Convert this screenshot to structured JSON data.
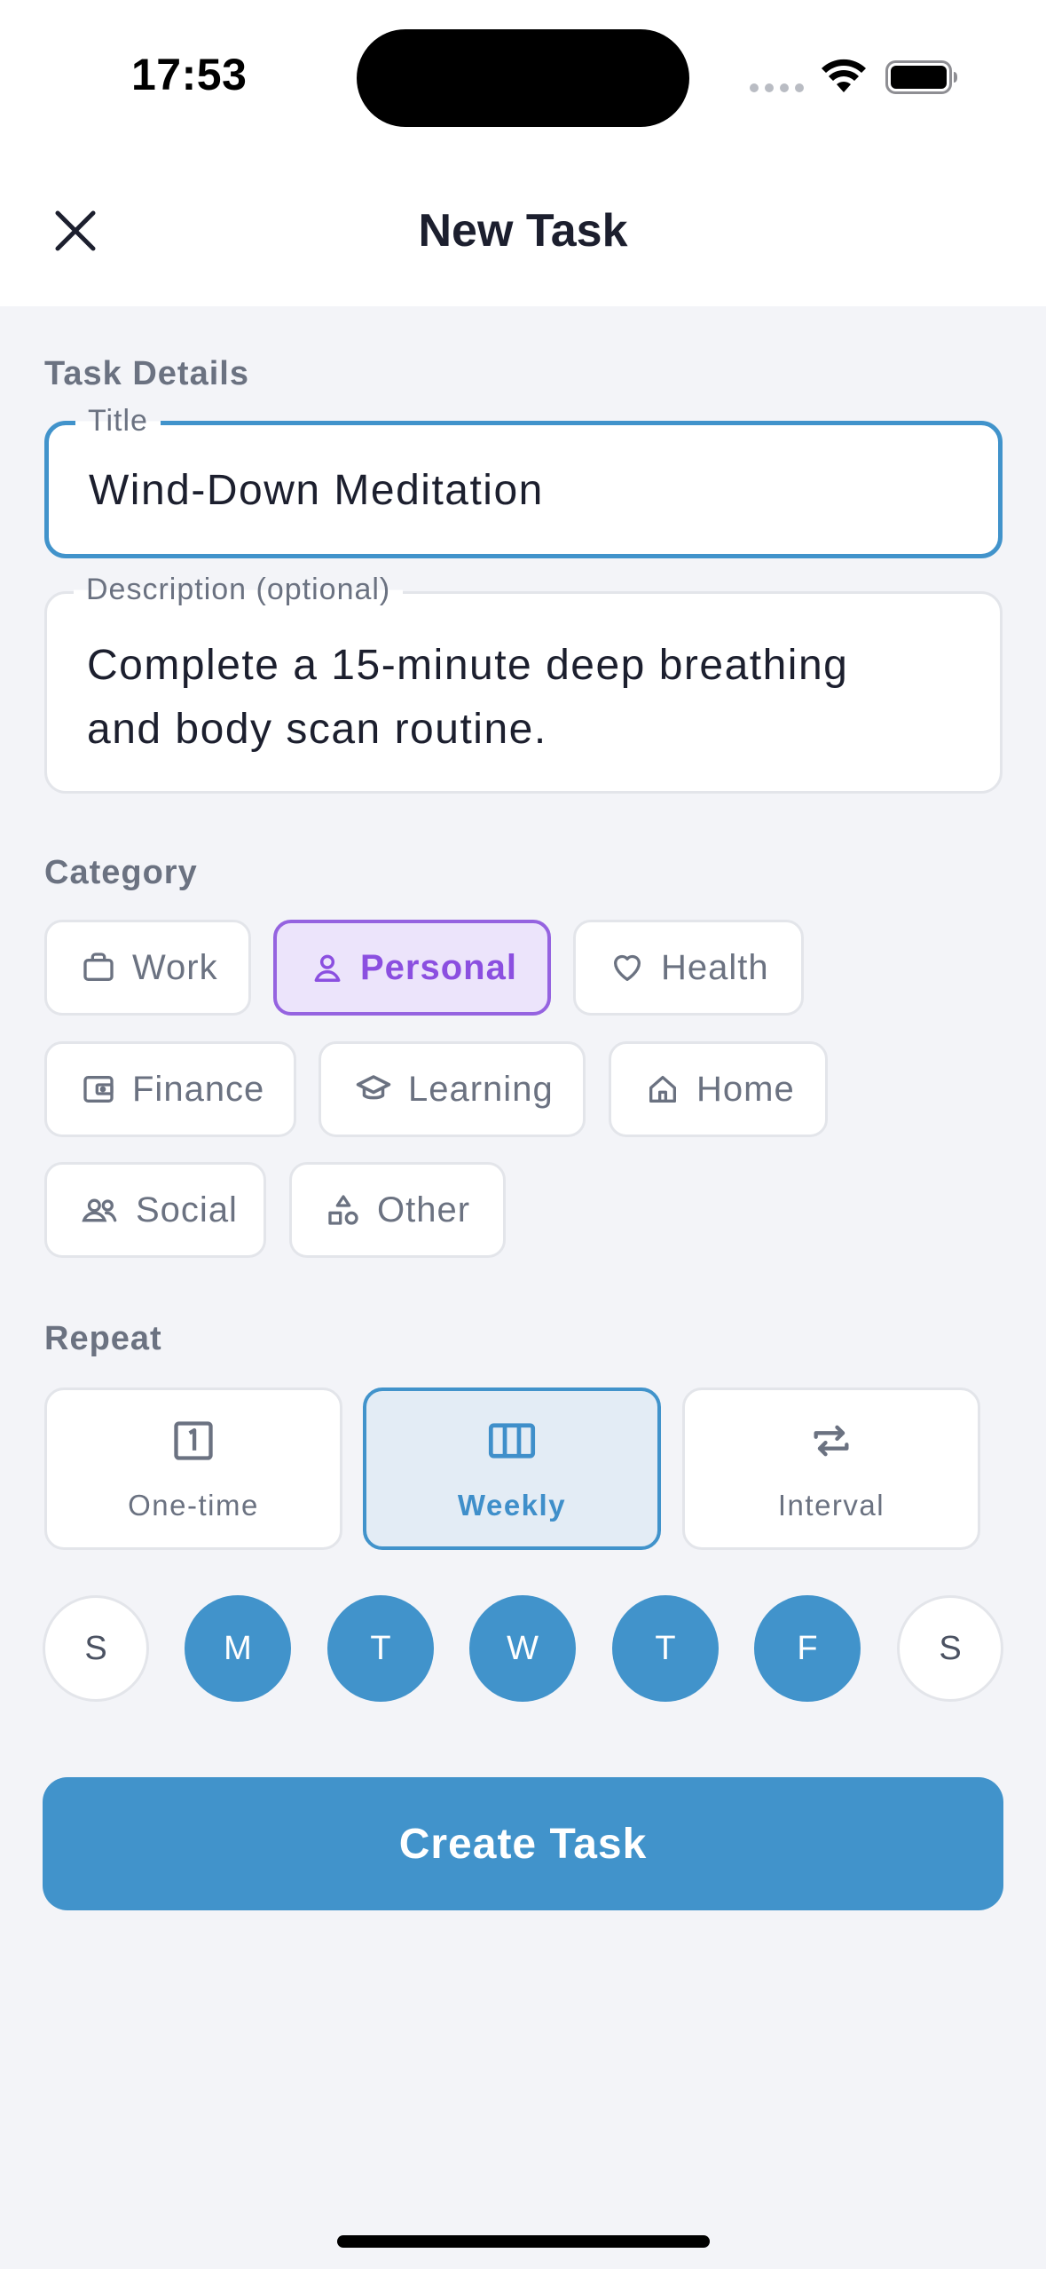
{
  "status_bar": {
    "time": "17:53"
  },
  "header": {
    "title": "New Task"
  },
  "task_details": {
    "section_label": "Task Details",
    "title_field": {
      "label": "Title",
      "value": "Wind-Down Meditation"
    },
    "description_field": {
      "label": "Description (optional)",
      "line1": "Complete a 15-minute deep breathing",
      "line2": "and body scan routine."
    }
  },
  "category": {
    "section_label": "Category",
    "selected": "Personal",
    "items": [
      {
        "label": "Work",
        "icon": "briefcase-icon"
      },
      {
        "label": "Personal",
        "icon": "person-icon"
      },
      {
        "label": "Health",
        "icon": "heart-icon"
      },
      {
        "label": "Finance",
        "icon": "wallet-icon"
      },
      {
        "label": "Learning",
        "icon": "graduation-cap-icon"
      },
      {
        "label": "Home",
        "icon": "house-icon"
      },
      {
        "label": "Social",
        "icon": "people-icon"
      },
      {
        "label": "Other",
        "icon": "shapes-icon"
      }
    ]
  },
  "repeat": {
    "section_label": "Repeat",
    "selected": "Weekly",
    "options": [
      {
        "label": "One-time",
        "icon": "one-box-icon"
      },
      {
        "label": "Weekly",
        "icon": "columns-icon"
      },
      {
        "label": "Interval",
        "icon": "repeat-icon"
      }
    ],
    "days": [
      {
        "label": "S",
        "selected": false
      },
      {
        "label": "M",
        "selected": true
      },
      {
        "label": "T",
        "selected": true
      },
      {
        "label": "W",
        "selected": true
      },
      {
        "label": "T",
        "selected": true
      },
      {
        "label": "F",
        "selected": true
      },
      {
        "label": "S",
        "selected": false
      }
    ]
  },
  "actions": {
    "create_label": "Create Task"
  },
  "colors": {
    "accent": "#4193cb",
    "category_selected": "#8b4fe0",
    "category_selected_bg": "#ece4fb",
    "background": "#f3f4f8"
  }
}
